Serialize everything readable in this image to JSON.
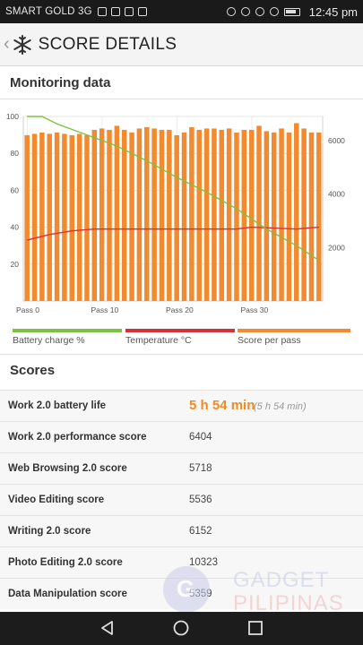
{
  "status_bar": {
    "carrier": "SMART GOLD 3G",
    "time": "12:45 pm"
  },
  "header": {
    "title": "SCORE DETAILS"
  },
  "monitoring": {
    "title": "Monitoring data"
  },
  "chart_data": {
    "type": "bar",
    "x_ticks": [
      "Pass 0",
      "Pass 10",
      "Pass 20",
      "Pass 30"
    ],
    "left_axis": {
      "ticks": [
        "100",
        "80",
        "60",
        "40",
        "20"
      ],
      "range": [
        0,
        100
      ]
    },
    "right_axis": {
      "ticks": [
        "6000",
        "4000",
        "2000"
      ],
      "range": [
        0,
        6900
      ]
    },
    "series": [
      {
        "name": "Score per pass",
        "type": "bar",
        "axis": "right",
        "color": "#f28b30",
        "values": [
          6200,
          6250,
          6300,
          6250,
          6300,
          6250,
          6200,
          6250,
          6200,
          6400,
          6450,
          6400,
          6550,
          6400,
          6300,
          6450,
          6500,
          6450,
          6400,
          6400,
          6200,
          6300,
          6500,
          6400,
          6450,
          6450,
          6400,
          6450,
          6300,
          6400,
          6400,
          6550,
          6350,
          6300,
          6450,
          6300,
          6650,
          6450,
          6300,
          6300
        ]
      },
      {
        "name": "Battery charge %",
        "type": "line",
        "axis": "left",
        "color": "#7cc242",
        "points": [
          [
            0,
            100
          ],
          [
            2,
            100
          ],
          [
            4,
            96
          ],
          [
            8,
            90
          ],
          [
            12,
            84
          ],
          [
            16,
            76
          ],
          [
            20,
            67
          ],
          [
            24,
            59
          ],
          [
            28,
            50
          ],
          [
            32,
            39
          ],
          [
            36,
            30
          ],
          [
            39,
            22
          ]
        ]
      },
      {
        "name": "Temperature °C",
        "type": "line",
        "axis": "left",
        "color": "#d6323a",
        "points": [
          [
            0,
            33
          ],
          [
            3,
            36
          ],
          [
            6,
            38
          ],
          [
            9,
            39
          ],
          [
            12,
            39
          ],
          [
            20,
            39
          ],
          [
            28,
            39
          ],
          [
            30,
            40
          ],
          [
            36,
            39
          ],
          [
            39,
            40
          ]
        ]
      }
    ],
    "legend": [
      "Battery charge %",
      "Temperature °C",
      "Score per pass"
    ],
    "legend_position": "bottom"
  },
  "scores": {
    "title": "Scores",
    "rows": [
      {
        "label": "Work 2.0 battery life",
        "value": "5 h 54 min",
        "sub": "(5 h 54 min)"
      },
      {
        "label": "Work 2.0 performance score",
        "value": "6404"
      },
      {
        "label": "Web Browsing 2.0 score",
        "value": "5718"
      },
      {
        "label": "Video Editing score",
        "value": "5536"
      },
      {
        "label": "Writing 2.0 score",
        "value": "6152"
      },
      {
        "label": "Photo Editing 2.0 score",
        "value": "10323"
      },
      {
        "label": "Data Manipulation score",
        "value": "5359"
      }
    ]
  },
  "watermark": {
    "line1": "GADGET",
    "line2": "PILIPINAS",
    "letter": "G"
  },
  "colors": {
    "accent": "#f08a23",
    "battery": "#7cc242",
    "temperature": "#d6323a",
    "score": "#f28b30"
  },
  "icons": [
    "back-chevron-icon",
    "snowflake-logo-icon",
    "back-nav-icon",
    "home-nav-icon",
    "recents-nav-icon"
  ]
}
